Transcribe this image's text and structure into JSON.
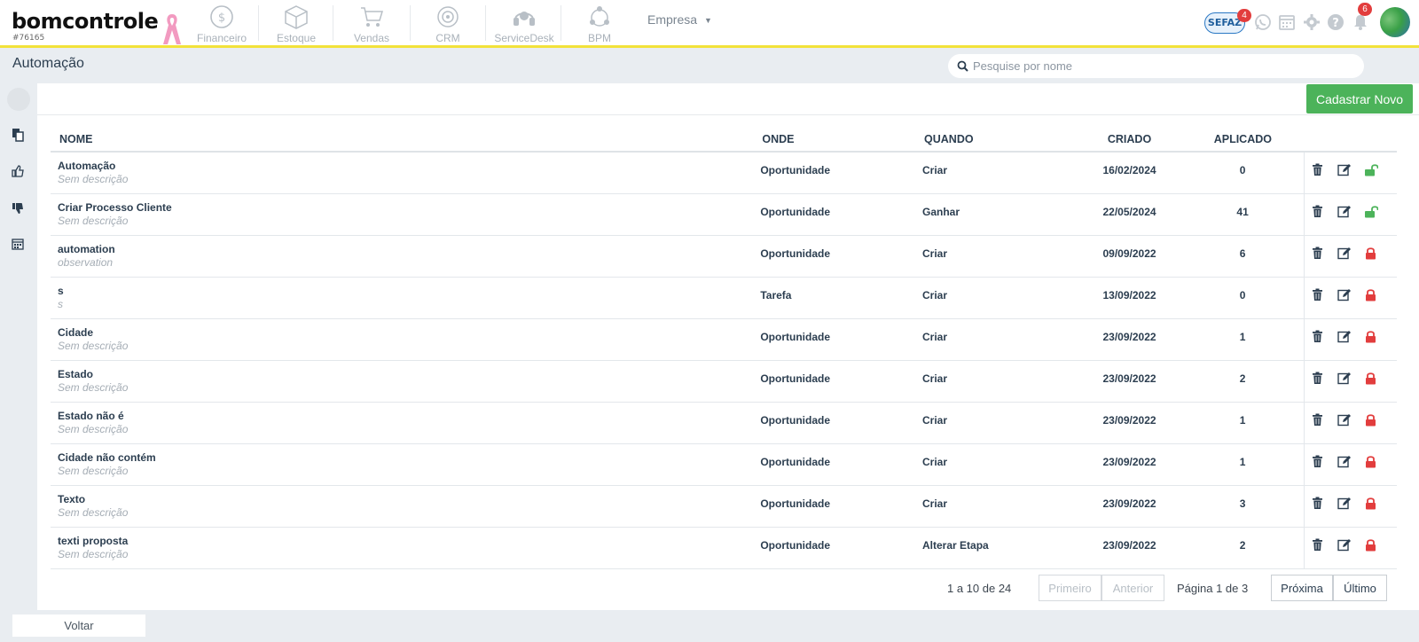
{
  "brand": {
    "logo": "bomcontrole",
    "account_id": "#76165"
  },
  "nav": [
    {
      "label": "Financeiro",
      "icon": "dollar-icon"
    },
    {
      "label": "Estoque",
      "icon": "box-icon"
    },
    {
      "label": "Vendas",
      "icon": "cart-icon"
    },
    {
      "label": "CRM",
      "icon": "target-icon"
    },
    {
      "label": "ServiceDesk",
      "icon": "headset-icon"
    },
    {
      "label": "BPM",
      "icon": "flow-icon"
    }
  ],
  "empresa": {
    "label": "Empresa"
  },
  "header_icons": {
    "sefaz": "SEFAZ",
    "sefaz_badge": "4",
    "notifications_badge": "6"
  },
  "page": {
    "title": "Automação"
  },
  "search": {
    "placeholder": "Pesquise por nome"
  },
  "toolbar": {
    "new_label": "Cadastrar Novo"
  },
  "table": {
    "columns": [
      "NOME",
      "ONDE",
      "QUANDO",
      "CRIADO",
      "APLICADO"
    ],
    "rows": [
      {
        "name": "Automação",
        "desc": "Sem descrição",
        "onde": "Oportunidade",
        "quando": "Criar",
        "criado": "16/02/2024",
        "aplicado": "0",
        "locked": false
      },
      {
        "name": "Criar Processo Cliente",
        "desc": "Sem descrição",
        "onde": "Oportunidade",
        "quando": "Ganhar",
        "criado": "22/05/2024",
        "aplicado": "41",
        "locked": false
      },
      {
        "name": "automation",
        "desc": "observation",
        "onde": "Oportunidade",
        "quando": "Criar",
        "criado": "09/09/2022",
        "aplicado": "6",
        "locked": true
      },
      {
        "name": "s",
        "desc": "s",
        "onde": "Tarefa",
        "quando": "Criar",
        "criado": "13/09/2022",
        "aplicado": "0",
        "locked": true
      },
      {
        "name": "Cidade",
        "desc": "Sem descrição",
        "onde": "Oportunidade",
        "quando": "Criar",
        "criado": "23/09/2022",
        "aplicado": "1",
        "locked": true
      },
      {
        "name": "Estado",
        "desc": "Sem descrição",
        "onde": "Oportunidade",
        "quando": "Criar",
        "criado": "23/09/2022",
        "aplicado": "2",
        "locked": true
      },
      {
        "name": "Estado não é",
        "desc": "Sem descrição",
        "onde": "Oportunidade",
        "quando": "Criar",
        "criado": "23/09/2022",
        "aplicado": "1",
        "locked": true
      },
      {
        "name": "Cidade não contém",
        "desc": "Sem descrição",
        "onde": "Oportunidade",
        "quando": "Criar",
        "criado": "23/09/2022",
        "aplicado": "1",
        "locked": true
      },
      {
        "name": "Texto",
        "desc": "Sem descrição",
        "onde": "Oportunidade",
        "quando": "Criar",
        "criado": "23/09/2022",
        "aplicado": "3",
        "locked": true
      },
      {
        "name": "texti proposta",
        "desc": "Sem descrição",
        "onde": "Oportunidade",
        "quando": "Alterar Etapa",
        "criado": "23/09/2022",
        "aplicado": "2",
        "locked": true
      }
    ]
  },
  "pagination": {
    "summary": "1 a 10 de 24",
    "first": "Primeiro",
    "prev": "Anterior",
    "page_text": "Página 1 de 3",
    "next": "Próxima",
    "last": "Último"
  },
  "footer": {
    "back_label": "Voltar"
  },
  "colors": {
    "accent_bar": "#f2e23a",
    "primary_button": "#4cb35a",
    "unlocked": "#4cb35a",
    "locked": "#e23d3d",
    "badge": "#e23d3d"
  }
}
